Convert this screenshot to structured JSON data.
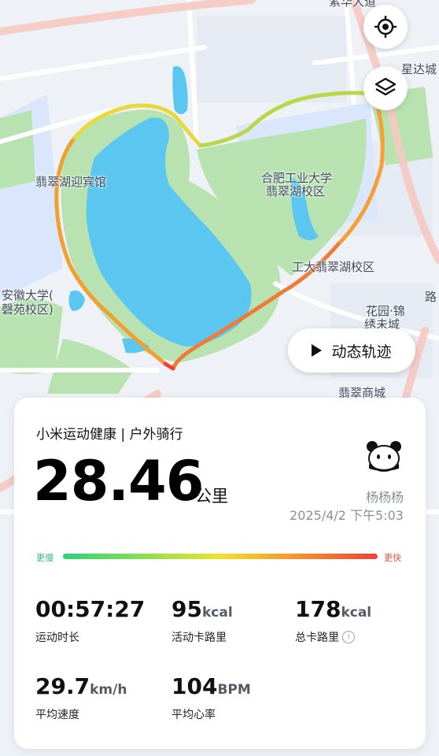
{
  "map": {
    "labels": {
      "top": "紫华大道",
      "top_right": "星达城",
      "hotel": "翡翠湖迎宾馆",
      "hfut_1": "合肥工业大学",
      "hfut_2": "翡翠湖校区",
      "hfut_campus": "工大翡翠湖校区",
      "ahu_1": "安徽大学(",
      "ahu_2": "磬苑校区)",
      "garden_1": "花园·锦",
      "garden_2": "绣未城",
      "bottom": "翡翠商城",
      "road_right": "路"
    },
    "buttons": {
      "locate_icon": "crosshair-icon",
      "layers_icon": "layers-icon",
      "replay_label": "动态轨迹"
    }
  },
  "workout": {
    "app_title": "小米运动健康 | 户外骑行",
    "distance": "28.46",
    "distance_unit": "公里",
    "username": "杨杨杨",
    "datetime": "2025/4/2 下午5:03",
    "speed_slow": "更慢",
    "speed_fast": "更快",
    "colors": {
      "slow": "#2ad37a",
      "mid": "#f1e22e",
      "fast": "#f0413a"
    },
    "stats": [
      {
        "value": "00:57:27",
        "unit": "",
        "label": "运动时长"
      },
      {
        "value": "95",
        "unit": "kcal",
        "label": "活动卡路里"
      },
      {
        "value": "178",
        "unit": "kcal",
        "label": "总卡路里"
      },
      {
        "value": "29.7",
        "unit": "km/h",
        "label": "平均速度"
      },
      {
        "value": "104",
        "unit": "BPM",
        "label": "平均心率"
      }
    ]
  }
}
